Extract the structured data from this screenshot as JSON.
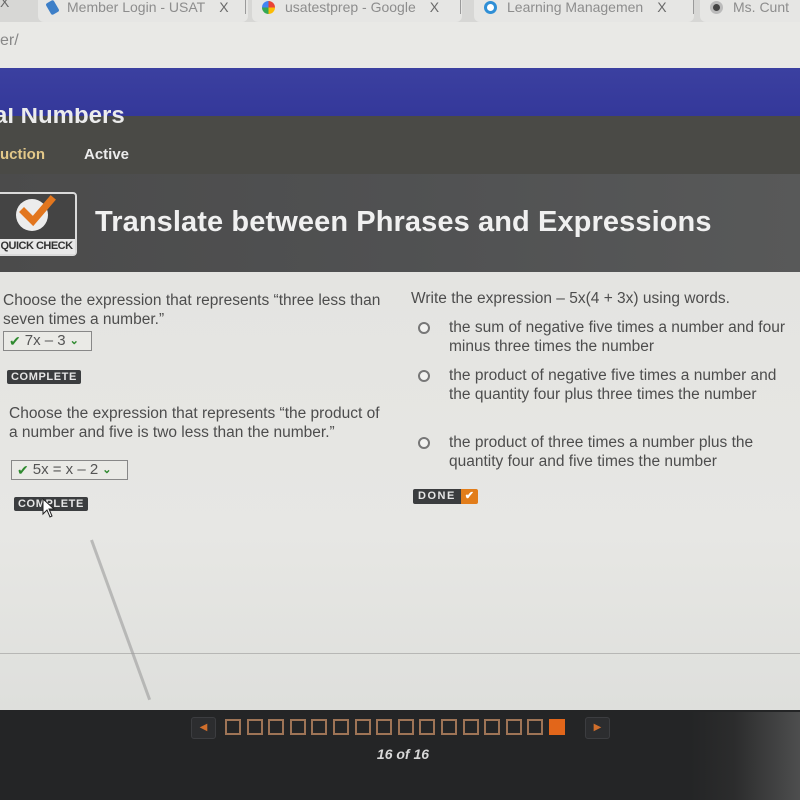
{
  "browser": {
    "leading_close": "X",
    "tabs": [
      {
        "label": "Member Login - USAT",
        "icon": "cursor-icon",
        "close": "X"
      },
      {
        "label": "usatestprep - Google",
        "icon": "google-icon",
        "close": "X"
      },
      {
        "label": "Learning Managemen",
        "icon": "lms-icon",
        "close": "X"
      },
      {
        "label": "Ms. Cunt",
        "icon": "site-icon",
        "close": ""
      }
    ],
    "address_fragment": "er/"
  },
  "lesson": {
    "title": "al Numbers",
    "tabs": [
      {
        "label": "uction",
        "state": "highlighted"
      },
      {
        "label": "Active",
        "state": "current"
      }
    ]
  },
  "activity": {
    "badge_label": "QUICK CHECK",
    "title": "Translate between Phrases and Expressions"
  },
  "questions": [
    {
      "prompt": "Choose the expression that represents “three less than seven times a number.”",
      "selected_answer": "7x – 3",
      "check_mark": "✔",
      "status": "COMPLETE"
    },
    {
      "prompt": "Choose the expression that represents “the product of a number and five is two less than the number.”",
      "selected_answer": "5x = x – 2",
      "check_mark": "✔",
      "status": "COMPLETE"
    }
  ],
  "multiple_choice": {
    "prompt": "Write the expression – 5x(4 + 3x) using words.",
    "options": [
      {
        "text": "the sum of negative five times a number and four minus three times the number",
        "selected": false
      },
      {
        "text": "the product of negative five times a number and the quantity four plus three times the number",
        "selected": false
      },
      {
        "text": "the product of three times a number plus the quantity four and five times the number",
        "selected": false
      }
    ],
    "done_label": "DONE",
    "done_check": "✔"
  },
  "pagination": {
    "prev": "◀",
    "next": "▶",
    "total_pages": 16,
    "current_page": 16,
    "label": "16 of 16"
  },
  "colors": {
    "site_header": "#34389a",
    "accent_orange": "#e2661a",
    "check_green": "#2f8a2f",
    "instruction_tab": "#e3c889"
  }
}
